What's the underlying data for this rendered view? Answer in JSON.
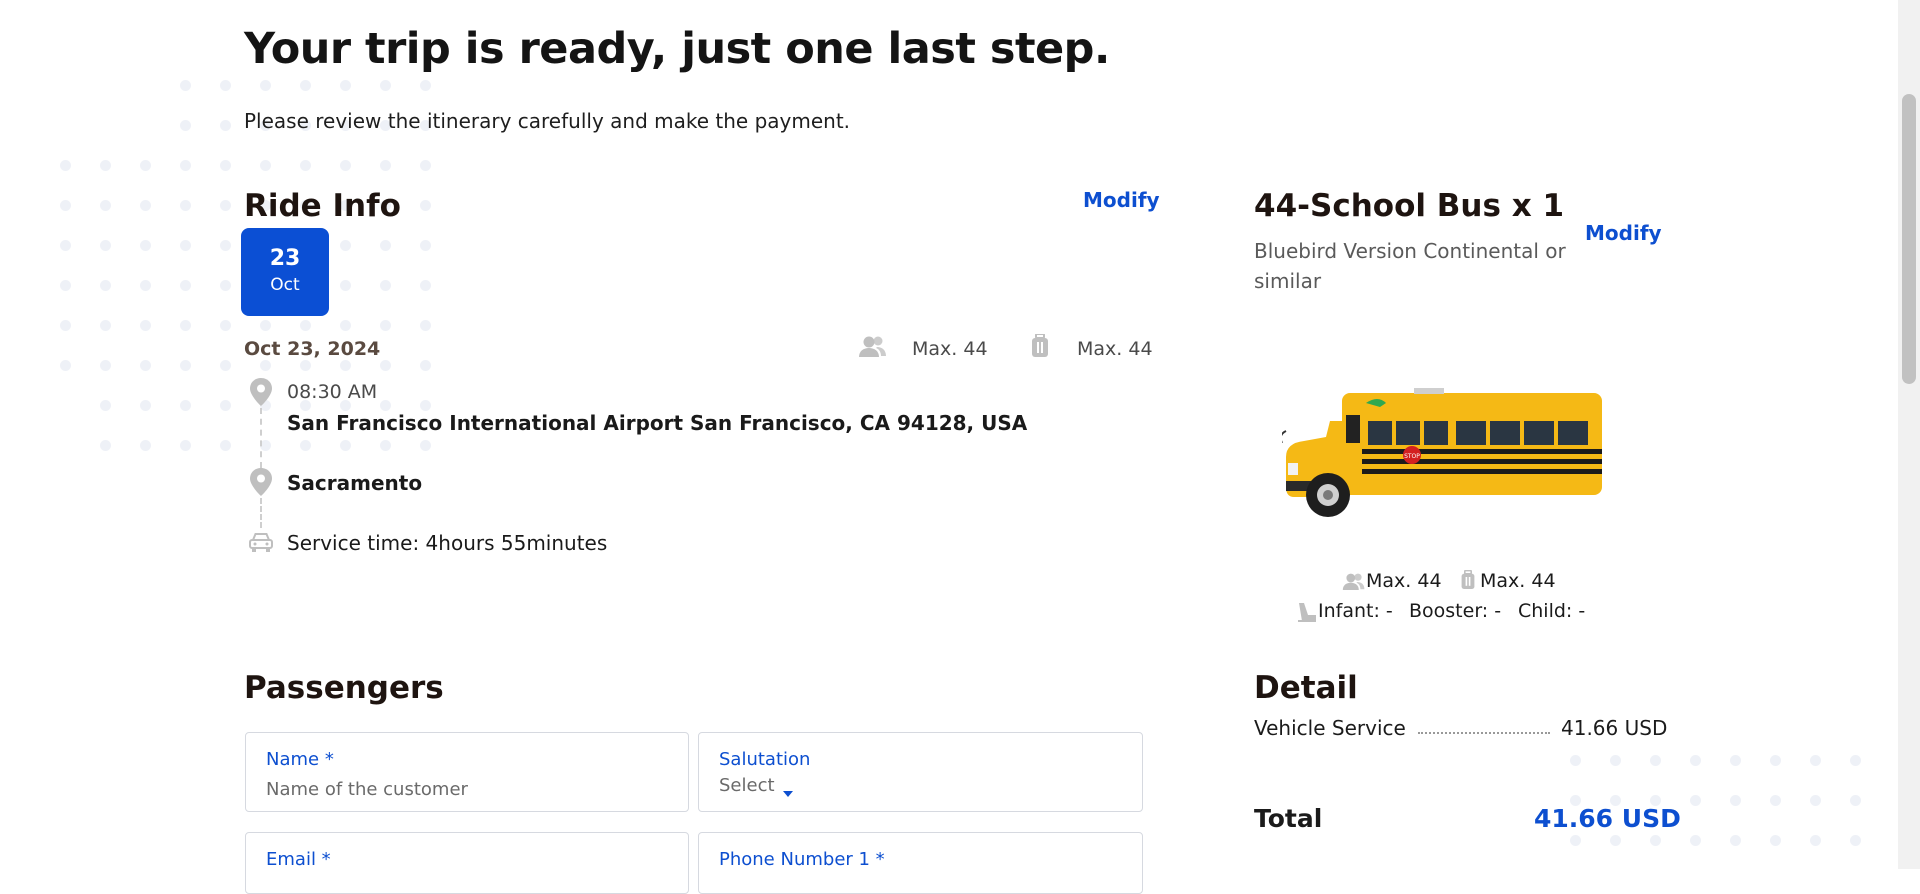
{
  "page": {
    "title": "Your trip is ready, just one last step.",
    "subtitle": "Please review the itinerary carefully and make the payment."
  },
  "ride_info": {
    "heading": "Ride Info",
    "modify_label": "Modify",
    "date_badge": {
      "day": "23",
      "month": "Oct"
    },
    "date": "Oct 23, 2024",
    "passengers_max": "Max. 44",
    "luggage_max": "Max. 44",
    "pickup_time": "08:30 AM",
    "pickup_address": "San Francisco International Airport San Francisco, CA 94128, USA",
    "dropoff": "Sacramento",
    "service_time": "Service time: 4hours 55minutes"
  },
  "vehicle": {
    "title": "44-School Bus x 1",
    "description": "Bluebird Version Continental or similar",
    "modify_label": "Modify",
    "passengers_max": "Max. 44",
    "luggage_max": "Max. 44",
    "seats": {
      "infant": "Infant: -",
      "booster": "Booster: -",
      "child": "Child: -"
    },
    "bus_color": "#f5b915",
    "stop_sign": "STOP"
  },
  "detail": {
    "heading": "Detail",
    "line_label": "Vehicle Service",
    "line_value": "41.66 USD",
    "total_label": "Total",
    "total_value": "41.66 USD"
  },
  "passengers": {
    "heading": "Passengers",
    "fields": {
      "name_label": "Name *",
      "name_placeholder": "Name of the customer",
      "salutation_label": "Salutation",
      "salutation_value": "Select",
      "email_label": "Email *",
      "phone_label": "Phone Number 1 *"
    }
  },
  "colors": {
    "accent": "#0b4fd4",
    "text": "#1b1b1b",
    "muted_icon": "#bfbfbf"
  }
}
